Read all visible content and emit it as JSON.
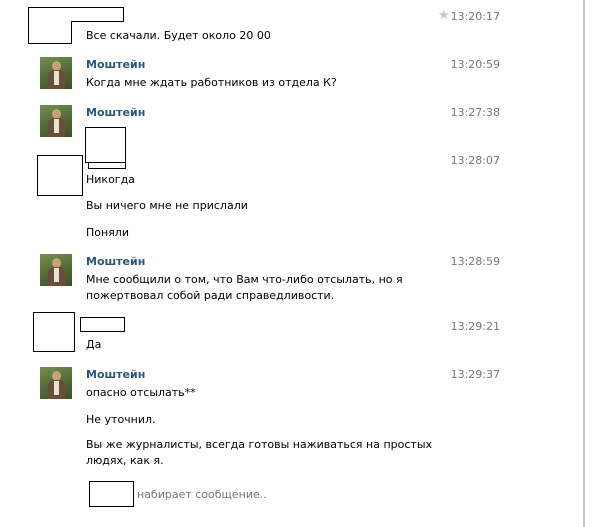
{
  "conversation": {
    "messages": [
      {
        "author": "",
        "time": "13:20:17",
        "lines": [
          "Все скачали. Будет около 20 00"
        ]
      },
      {
        "author": "Моштейн",
        "time": "13:20:59",
        "lines": [
          "Когда мне ждать работников из отдела К?"
        ]
      },
      {
        "author": "Моштейн",
        "time": "13:27:38",
        "lines": []
      },
      {
        "author": "",
        "time": "13:28:07",
        "lines": [
          "Никогда",
          "Вы ничего мне не прислали",
          "Поняли"
        ]
      },
      {
        "author": "Моштейн",
        "time": "13:28:59",
        "lines": [
          "Мне сообщили о том, что Вам что-либо отсылать, но я пожертвовал собой ради справедливости."
        ]
      },
      {
        "author": "",
        "time": "13:29:21",
        "lines": [
          "Да"
        ]
      },
      {
        "author": "Моштейн",
        "time": "13:29:37",
        "lines": [
          "опасно отсылать**",
          "Не уточнил.",
          "Вы же журналисты, всегда готовы наживаться на простых людях, как я."
        ]
      }
    ],
    "typing_text": "набирает сообщение..",
    "star_icon": "star-icon",
    "colors": {
      "author": "#2b587a",
      "time": "#777777",
      "star": "#c4c4c4"
    }
  }
}
